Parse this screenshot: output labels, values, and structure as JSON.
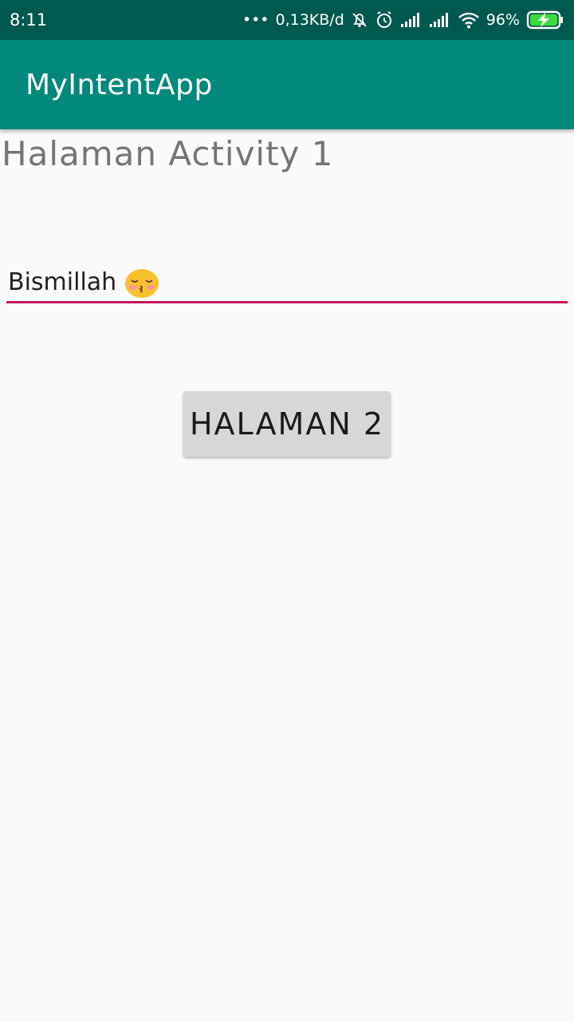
{
  "status_bar": {
    "time": "8:11",
    "dots": "•••",
    "network_speed": "0,13KB/d",
    "battery_percent": "96%",
    "icons": [
      "mute-icon",
      "alarm-icon",
      "signal-icon",
      "signal-icon",
      "wifi-icon",
      "battery-charging-icon"
    ]
  },
  "app_bar": {
    "title": "MyIntentApp"
  },
  "main": {
    "heading": "Halaman Activity 1",
    "input_value": "Bismillah",
    "input_emoji": "kissing-face-emoji",
    "button_label": "HALAMAN 2"
  },
  "colors": {
    "status_bar": "#00594f",
    "app_bar": "#00897b",
    "input_underline": "#c2185b",
    "button": "#d6d7d7",
    "background": "#fafafa"
  }
}
